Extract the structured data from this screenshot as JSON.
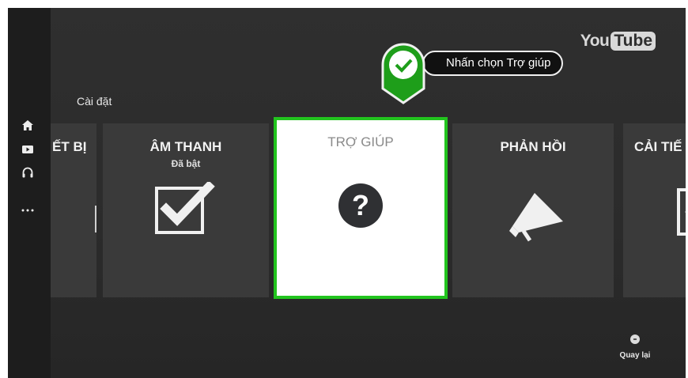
{
  "logo": {
    "part1": "You",
    "part2": "Tube"
  },
  "header": {
    "settings_label": "Cài đặt"
  },
  "tooltip": {
    "text": "Nhấn chọn Trợ giúp"
  },
  "sidebar": {
    "icons": [
      "home-icon",
      "subscriptions-icon",
      "headphones-icon",
      "more-icon"
    ]
  },
  "cards": [
    {
      "id": "thietbi",
      "title": "ẾT BỊ",
      "subtitle": ""
    },
    {
      "id": "amthanh",
      "title": "ÂM THANH",
      "subtitle": "Đã bật"
    },
    {
      "id": "trogiup",
      "title": "TRỢ GIÚP",
      "subtitle": "",
      "icon_glyph": "?"
    },
    {
      "id": "phanhoi",
      "title": "PHẢN HỒI",
      "subtitle": ""
    },
    {
      "id": "caitien",
      "title": "CẢI TIẾ",
      "subtitle": ""
    }
  ],
  "footer": {
    "back_label": "Quay lại"
  },
  "colors": {
    "focus_border": "#22c41e",
    "background": "#2a2a2a",
    "card": "#3a3a3a"
  }
}
